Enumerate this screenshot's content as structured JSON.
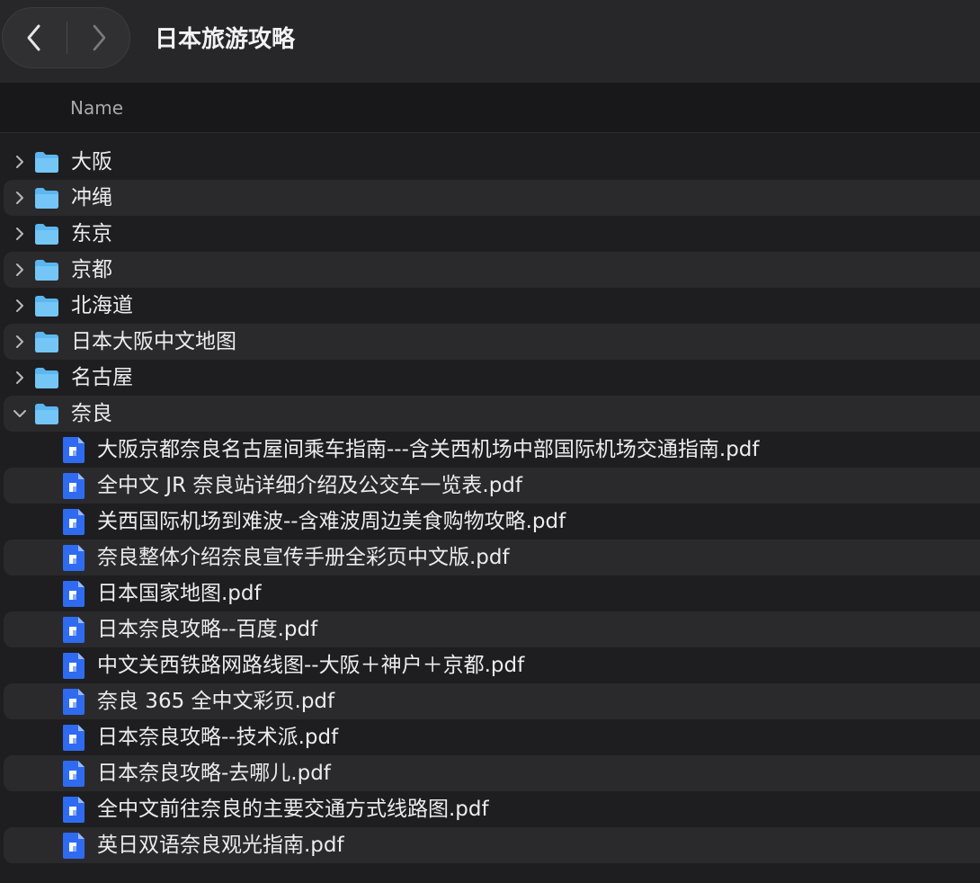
{
  "window": {
    "title": "日本旅游攻略"
  },
  "columns": {
    "name": "Name"
  },
  "folders": [
    {
      "name": "大阪",
      "expanded": false
    },
    {
      "name": "冲绳",
      "expanded": false
    },
    {
      "name": "东京",
      "expanded": false
    },
    {
      "name": "京都",
      "expanded": false
    },
    {
      "name": "北海道",
      "expanded": false
    },
    {
      "name": "日本大阪中文地图",
      "expanded": false
    },
    {
      "name": "名古屋",
      "expanded": false
    },
    {
      "name": "奈良",
      "expanded": true
    }
  ],
  "nara_files": [
    "大阪京都奈良名古屋间乘车指南---含关西机场中部国际机场交通指南.pdf",
    "全中文 JR 奈良站详细介绍及公交车一览表.pdf",
    "关西国际机场到难波--含难波周边美食购物攻略.pdf",
    "奈良整体介绍奈良宣传手册全彩页中文版.pdf",
    "日本国家地图.pdf",
    "日本奈良攻略--百度.pdf",
    "中文关西铁路网路线图--大阪＋神户＋京都.pdf",
    "奈良 365 全中文彩页.pdf",
    "日本奈良攻略--技术派.pdf",
    "日本奈良攻略-去哪儿.pdf",
    "全中文前往奈良的主要交通方式线路图.pdf",
    "英日双语奈良观光指南.pdf"
  ],
  "colors": {
    "folder": "#5cb6f0",
    "file": "#2f6bf0"
  }
}
